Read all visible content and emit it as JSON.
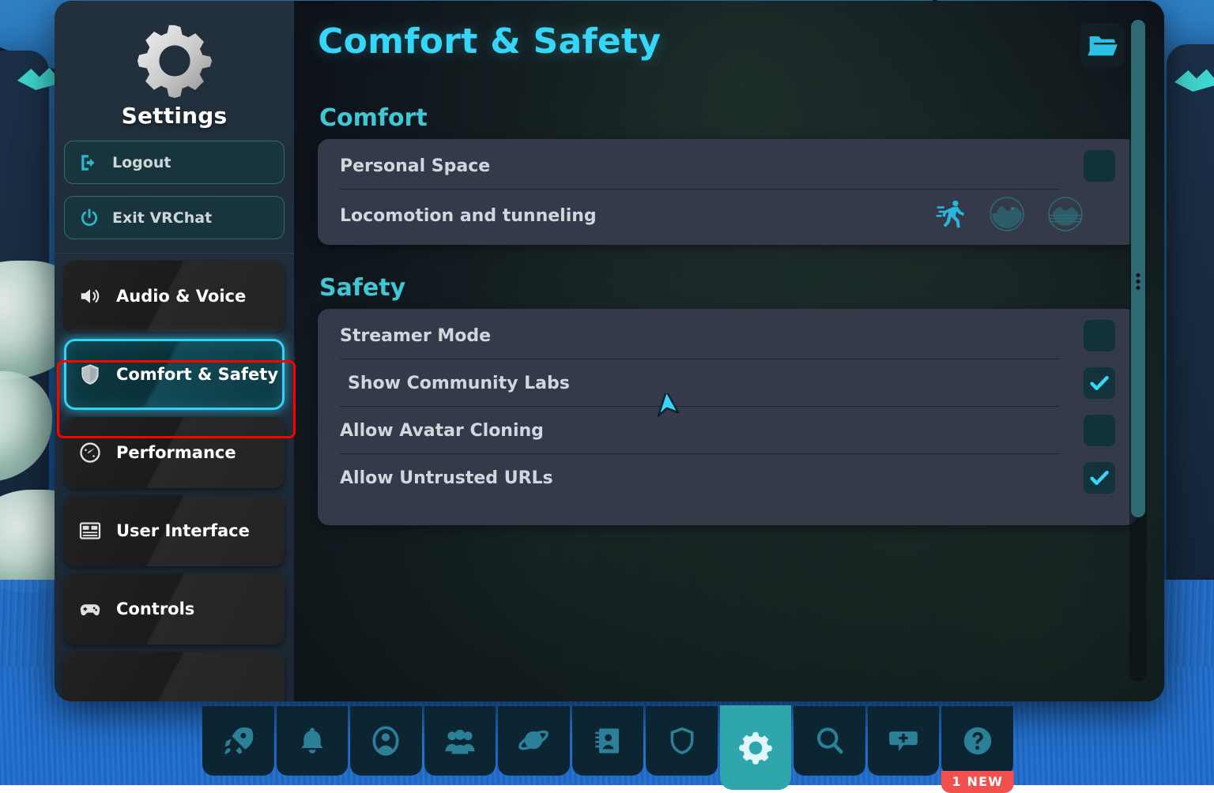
{
  "sidebar": {
    "title": "Settings",
    "logo_icon": "gear-icon",
    "account_actions": [
      {
        "label": "Logout",
        "icon": "logout-icon"
      },
      {
        "label": "Exit VRChat",
        "icon": "power-icon"
      }
    ],
    "nav_items": [
      {
        "label": "Audio & Voice",
        "icon": "speaker-icon",
        "selected": false
      },
      {
        "label": "Comfort & Safety",
        "icon": "shield-icon",
        "selected": true
      },
      {
        "label": "Performance",
        "icon": "gauge-icon",
        "selected": false
      },
      {
        "label": "User Interface",
        "icon": "window-icon",
        "selected": false
      },
      {
        "label": "Controls",
        "icon": "gamepad-icon",
        "selected": false
      }
    ]
  },
  "header": {
    "title": "Comfort & Safety",
    "folder_button_icon": "folder-open-icon",
    "accent_color": "#35d6f7"
  },
  "main": {
    "sections": [
      {
        "heading": "Comfort",
        "rows": [
          {
            "label": "Personal Space",
            "control": "checkbox",
            "checked": false,
            "indent": false
          },
          {
            "label": "Locomotion and tunneling",
            "control": "locomotion",
            "indent": false,
            "options": [
              {
                "icon": "running-person-icon",
                "active": true
              },
              {
                "icon": "tunnel-vignette-small-icon",
                "active": false
              },
              {
                "icon": "tunnel-vignette-large-icon",
                "active": false
              }
            ]
          }
        ]
      },
      {
        "heading": "Safety",
        "rows": [
          {
            "label": "Streamer Mode",
            "control": "checkbox",
            "checked": false,
            "indent": false
          },
          {
            "label": "Show Community Labs",
            "control": "checkbox",
            "checked": true,
            "indent": true
          },
          {
            "label": "Allow Avatar Cloning",
            "control": "checkbox",
            "checked": false,
            "indent": false
          },
          {
            "label": "Allow Untrusted URLs",
            "control": "checkbox",
            "checked": true,
            "indent": false
          }
        ]
      }
    ]
  },
  "scrollbar": {
    "thumb_color": "#2e6a72",
    "grip_icon": "grip-dots-icon"
  },
  "taskbar": {
    "buttons": [
      {
        "icon": "rocket-icon",
        "active": false,
        "badge": null
      },
      {
        "icon": "bell-icon",
        "active": false,
        "badge": null
      },
      {
        "icon": "profile-icon",
        "active": false,
        "badge": null
      },
      {
        "icon": "social-group-icon",
        "active": false,
        "badge": null
      },
      {
        "icon": "planet-icon",
        "active": false,
        "badge": null
      },
      {
        "icon": "notebook-icon",
        "active": false,
        "badge": null
      },
      {
        "icon": "shield-icon",
        "active": false,
        "badge": null
      },
      {
        "icon": "gear-icon",
        "active": true,
        "badge": null
      },
      {
        "icon": "search-icon",
        "active": false,
        "badge": null
      },
      {
        "icon": "chat-plus-icon",
        "active": false,
        "badge": null
      },
      {
        "icon": "help-question-icon",
        "active": false,
        "badge": "1 NEW"
      }
    ]
  },
  "cursor": {
    "icon": "arrow-cursor-icon",
    "color": "#35d6f7"
  }
}
